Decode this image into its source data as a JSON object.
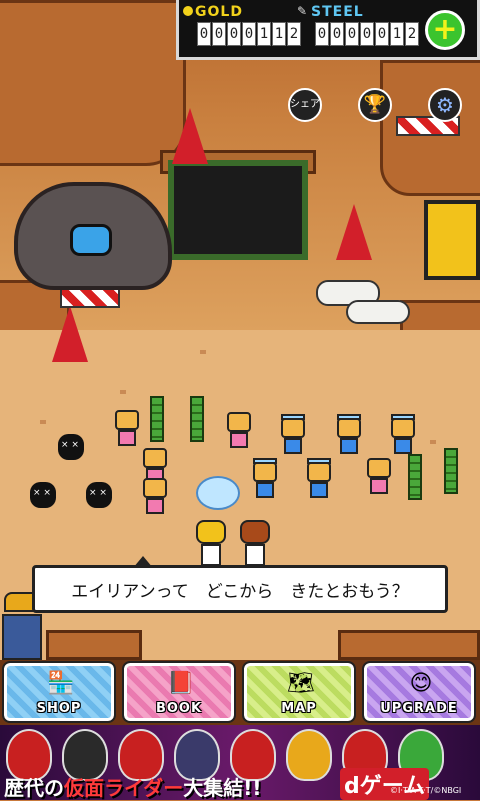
{
  "currency": {
    "gold_label": "GOLD",
    "gold_digits": [
      "0",
      "0",
      "0",
      "0",
      "1",
      "1",
      "2"
    ],
    "steel_label": "STEEL",
    "steel_digits": [
      "0",
      "0",
      "0",
      "0",
      "0",
      "1",
      "2"
    ],
    "add_label": "+"
  },
  "top_buttons": {
    "share_label": "シェア"
  },
  "dialog": {
    "text": "エイリアンって　どこから　きたとおもう？"
  },
  "menu": {
    "shop_label": "SHOP",
    "book_label": "BOOK",
    "map_label": "MAP",
    "upgrade_label": "UPGRADE"
  },
  "ad": {
    "text_prefix": "歴代の",
    "text_highlight": "仮面ライダー",
    "text_suffix": "大集結!!",
    "brand": "dゲーム",
    "copyright": "©I·T·A·T·T/©NBGI"
  },
  "colors": {
    "gold": "#f2d21b",
    "steel": "#5fc6f2",
    "plus_button": "#3bc42e"
  }
}
